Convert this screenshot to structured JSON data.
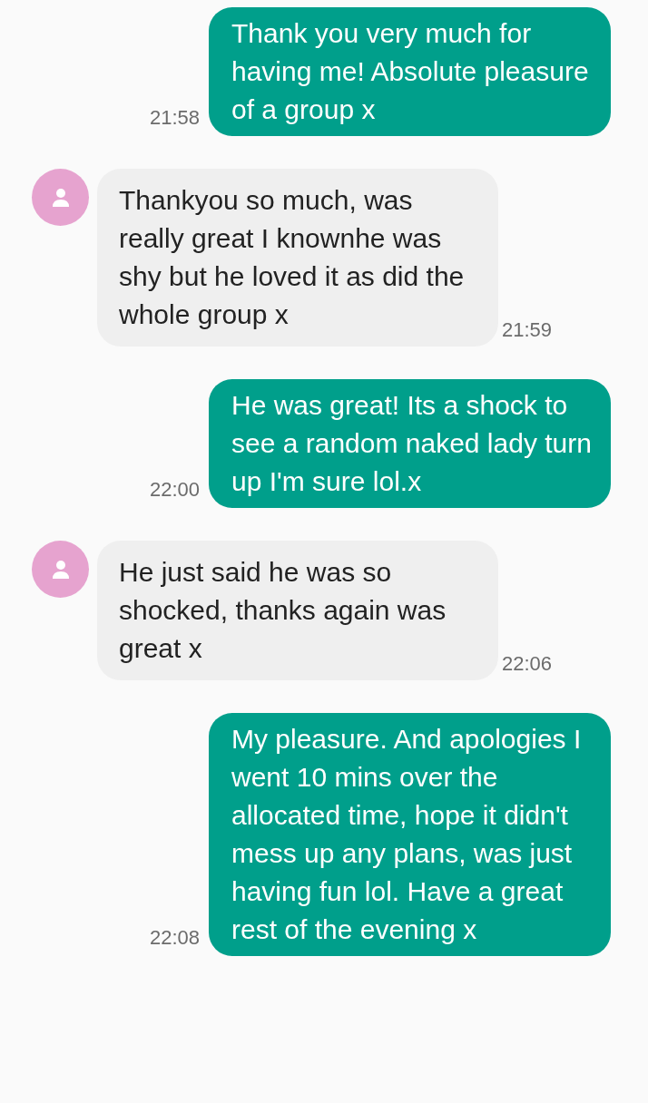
{
  "messages": [
    {
      "kind": "outgoing",
      "text": "Thank you very much for having me! Absolute pleasure of a group x",
      "time": "21:58"
    },
    {
      "kind": "incoming",
      "text": "Thankyou so much, was really great I knownhe was shy but he loved it as did the whole group x",
      "time": "21:59"
    },
    {
      "kind": "outgoing",
      "text": "He was great! Its a shock to see a random naked lady turn up I'm sure lol.x",
      "time": "22:00"
    },
    {
      "kind": "incoming",
      "text": "He just said he was so shocked, thanks again was great x",
      "time": "22:06"
    },
    {
      "kind": "outgoing",
      "text": "My pleasure. And apologies I went 10 mins over the allocated time, hope it didn't mess up any plans, was just having fun lol. Have a great rest of the evening x",
      "time": "22:08"
    }
  ]
}
